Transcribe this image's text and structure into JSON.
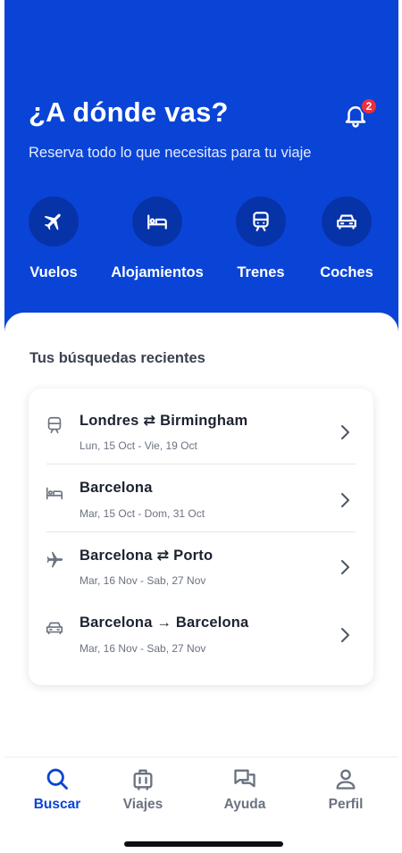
{
  "header": {
    "title": "¿A dónde vas?",
    "subtitle": "Reserva todo lo que necesitas para tu viaje",
    "notifications": {
      "icon": "bell-icon",
      "count": "2"
    }
  },
  "categories": [
    {
      "label": "Vuelos",
      "icon": "plane-icon"
    },
    {
      "label": "Alojamientos",
      "icon": "bed-icon"
    },
    {
      "label": "Trenes",
      "icon": "train-icon"
    },
    {
      "label": "Coches",
      "icon": "car-icon"
    }
  ],
  "recent": {
    "title": "Tus búsquedas recientes",
    "items": [
      {
        "title": "Londres ⇄ Birmingham",
        "dates": "Lun, 15 Oct - Vie, 19 Oct",
        "icon": "train-icon"
      },
      {
        "title": "Barcelona",
        "dates": "Mar, 15 Oct - Dom, 31 Oct",
        "icon": "bed-icon"
      },
      {
        "title": "Barcelona ⇄ Porto",
        "dates": "Mar, 16 Nov - Sab, 27 Nov",
        "icon": "plane-icon"
      },
      {
        "title": "Barcelona → Barcelona",
        "dates": "Mar, 16 Nov - Sab, 27 Nov",
        "icon": "car-icon"
      }
    ]
  },
  "tabs": [
    {
      "label": "Buscar",
      "icon": "search-icon",
      "active": true
    },
    {
      "label": "Viajes",
      "icon": "suitcase-icon",
      "active": false
    },
    {
      "label": "Ayuda",
      "icon": "chat-icon",
      "active": false
    },
    {
      "label": "Perfil",
      "icon": "profile-icon",
      "active": false
    }
  ],
  "colors": {
    "brand": "#0a44d6",
    "brand_dark": "#0733a8",
    "badge": "#ef2f3a",
    "text": "#1c2230",
    "muted": "#6b7280"
  }
}
